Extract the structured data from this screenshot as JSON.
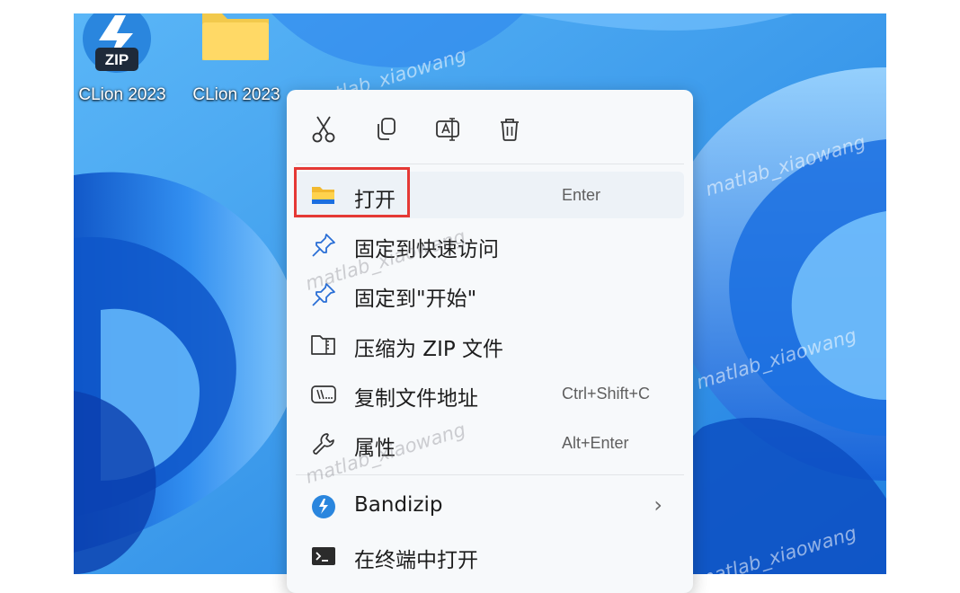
{
  "colors": {
    "desktop": "#3f9ef0",
    "menu_bg": "#f7f9fb",
    "highlight_box": "#e53935",
    "bandizip_blue": "#2a86de"
  },
  "desktop": {
    "icons": [
      {
        "label": "CLion 2023",
        "icon": "zip-archive-icon",
        "badge": "ZIP"
      },
      {
        "label": "CLion 2023",
        "icon": "folder-icon"
      }
    ],
    "watermark": "matlab_xiaowang"
  },
  "context_menu": {
    "toolbar": [
      {
        "icon": "cut-icon"
      },
      {
        "icon": "copy-icon"
      },
      {
        "icon": "rename-icon"
      },
      {
        "icon": "delete-icon"
      }
    ],
    "items": [
      {
        "label": "打开",
        "shortcut": "Enter",
        "icon": "folder-open-icon",
        "highlighted": true
      },
      {
        "label": "固定到快速访问",
        "shortcut": "",
        "icon": "pin-icon"
      },
      {
        "label": "固定到\"开始\"",
        "shortcut": "",
        "icon": "pin-icon"
      },
      {
        "label": "压缩为 ZIP 文件",
        "shortcut": "",
        "icon": "zip-folder-icon"
      },
      {
        "label": "复制文件地址",
        "shortcut": "Ctrl+Shift+C",
        "icon": "copy-path-icon"
      },
      {
        "label": "属性",
        "shortcut": "Alt+Enter",
        "icon": "wrench-icon"
      },
      {
        "label": "Bandizip",
        "shortcut": "",
        "icon": "bandizip-icon",
        "submenu": true
      },
      {
        "label": "在终端中打开",
        "shortcut": "",
        "icon": "terminal-icon"
      }
    ],
    "submenu_chevron": "›"
  }
}
